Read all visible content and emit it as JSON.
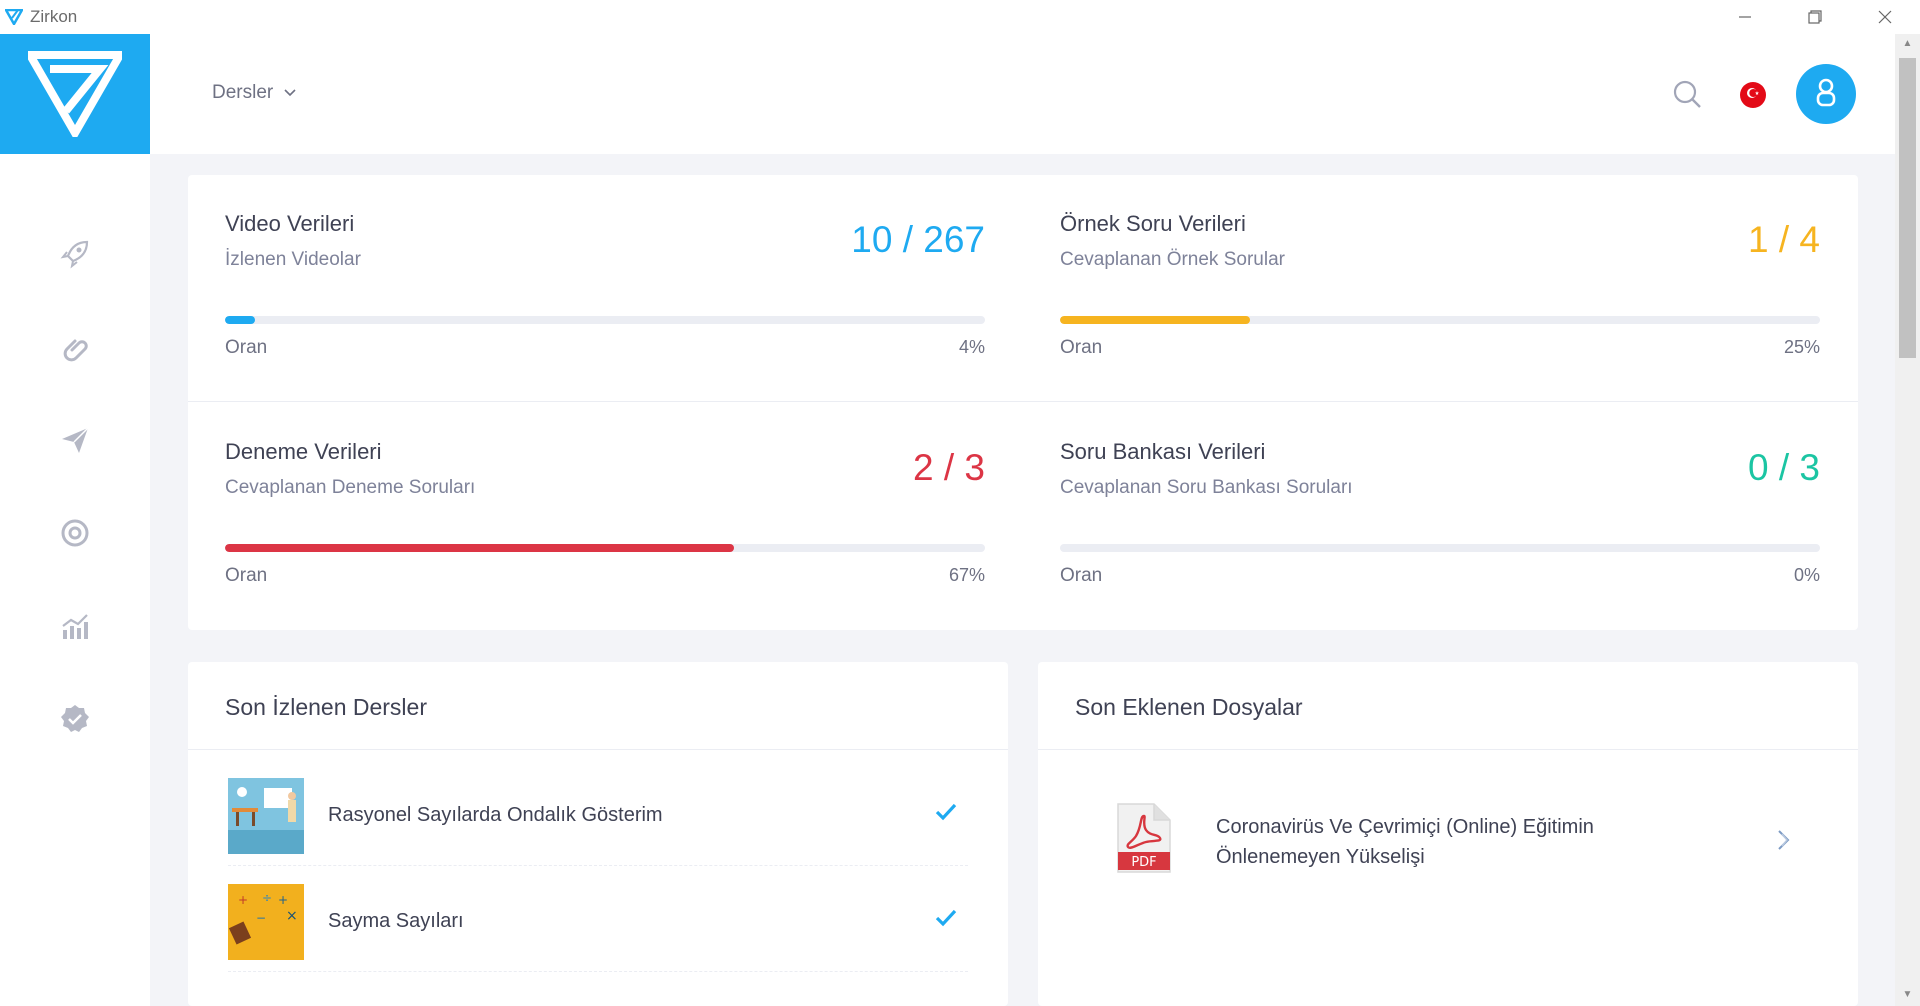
{
  "window": {
    "title": "Zirkon",
    "minimize": "—",
    "restore": "❐",
    "close": "✕"
  },
  "header": {
    "courses_label": "Dersler"
  },
  "stats": [
    {
      "title": "Video Verileri",
      "subtitle": "İzlenen Videolar",
      "value": "10 / 267",
      "ratio_label": "Oran",
      "percent": "4%",
      "fraction": 0.04,
      "color": "#1eaaf1"
    },
    {
      "title": "Örnek Soru Verileri",
      "subtitle": "Cevaplanan Örnek Sorular",
      "value": "1 / 4",
      "ratio_label": "Oran",
      "percent": "25%",
      "fraction": 0.25,
      "color": "#f6b420"
    },
    {
      "title": "Deneme Verileri",
      "subtitle": "Cevaplanan Deneme Soruları",
      "value": "2 / 3",
      "ratio_label": "Oran",
      "percent": "67%",
      "fraction": 0.67,
      "color": "#dc3545"
    },
    {
      "title": "Soru Bankası Verileri",
      "subtitle": "Cevaplanan Soru Bankası Soruları",
      "value": "0 / 3",
      "ratio_label": "Oran",
      "percent": "0%",
      "fraction": 0.0,
      "color": "#1bc5a3"
    }
  ],
  "recent_lessons": {
    "title": "Son İzlenen Dersler",
    "items": [
      {
        "title": "Rasyonel Sayılarda Ondalık Gösterim",
        "completed": true
      },
      {
        "title": "Sayma Sayıları",
        "completed": true
      }
    ]
  },
  "recent_files": {
    "title": "Son Eklenen Dosyalar",
    "items": [
      {
        "title": "Coronavirüs Ve Çevrimiçi (Online) Eğitimin Önlenemeyen Yükselişi",
        "type_label": "PDF"
      }
    ]
  },
  "colors": {
    "accent": "#1eaaf1",
    "check": "#1eaaf1"
  }
}
